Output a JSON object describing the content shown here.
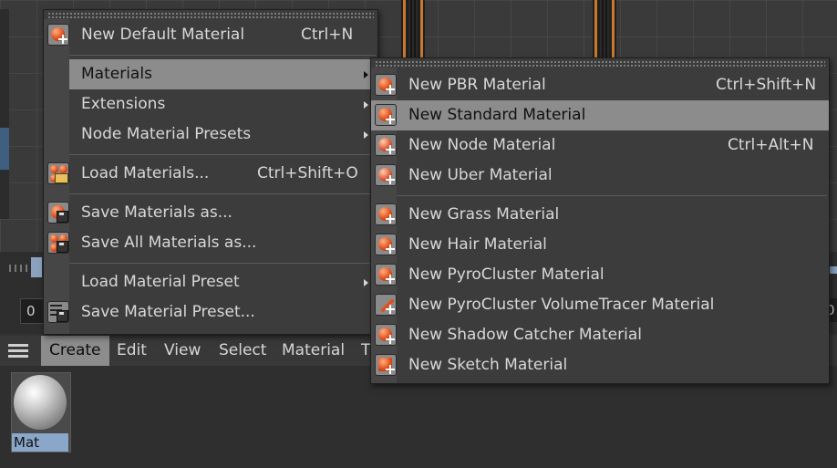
{
  "timeline": {
    "frame_left": "0",
    "frame_right": "0"
  },
  "menubar": {
    "items": [
      {
        "label": "Create",
        "active": true
      },
      {
        "label": "Edit"
      },
      {
        "label": "View"
      },
      {
        "label": "Select"
      },
      {
        "label": "Material"
      },
      {
        "label": "T"
      }
    ]
  },
  "material_browser": {
    "thumb_name": "Mat"
  },
  "main_menu": {
    "items": [
      {
        "label": "New Default Material",
        "shortcut": "Ctrl+N",
        "icon": "new-material-icon"
      },
      {
        "label": "Materials",
        "submenu": true,
        "highlighted": true
      },
      {
        "label": "Extensions",
        "submenu": true
      },
      {
        "label": "Node Material Presets",
        "submenu": true
      },
      {
        "label": "Load Materials...",
        "shortcut": "Ctrl+Shift+O",
        "icon": "load-materials-icon"
      },
      {
        "label": "Save Materials as...",
        "icon": "save-material-icon"
      },
      {
        "label": "Save All Materials as...",
        "icon": "save-all-materials-icon"
      },
      {
        "label": "Load Material Preset",
        "submenu": true
      },
      {
        "label": "Save Material Preset...",
        "icon": "save-preset-icon"
      }
    ]
  },
  "sub_menu": {
    "items": [
      {
        "label": "New PBR Material",
        "shortcut": "Ctrl+Shift+N",
        "icon": "pbr-material-icon"
      },
      {
        "label": "New Standard Material",
        "highlighted": true,
        "icon": "standard-material-icon"
      },
      {
        "label": "New Node Material",
        "shortcut": "Ctrl+Alt+N",
        "icon": "node-material-icon"
      },
      {
        "label": "New Uber Material",
        "icon": "uber-material-icon"
      },
      {
        "label": "New Grass Material",
        "icon": "grass-material-icon"
      },
      {
        "label": "New Hair Material",
        "icon": "hair-material-icon"
      },
      {
        "label": "New PyroCluster Material",
        "icon": "pyrocluster-material-icon"
      },
      {
        "label": "New PyroCluster VolumeTracer Material",
        "icon": "volumetracer-material-icon"
      },
      {
        "label": "New Shadow Catcher Material",
        "icon": "shadow-catcher-material-icon"
      },
      {
        "label": "New Sketch Material",
        "icon": "sketch-material-icon"
      }
    ]
  },
  "colors": {
    "highlight": "#8c8c8c",
    "menu_bg": "#3c3c3c",
    "accent_orange": "#e0501e",
    "selection_blue": "#8aa6c8"
  }
}
